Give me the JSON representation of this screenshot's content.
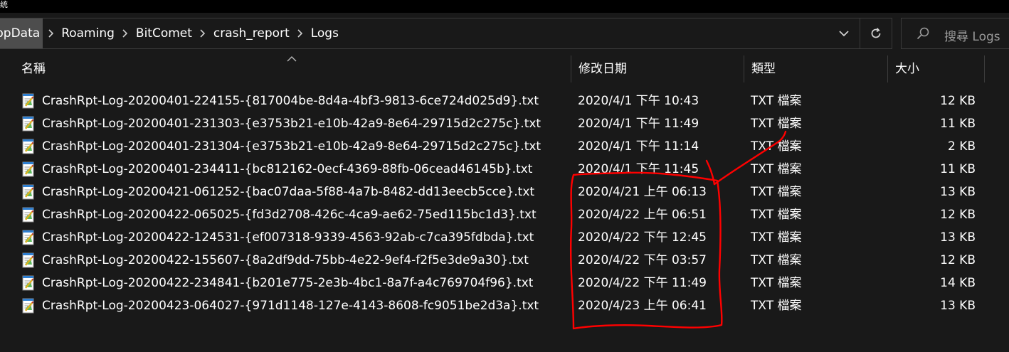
{
  "window": {
    "title_glyph": "统"
  },
  "breadcrumb": {
    "items": [
      "ppData",
      "Roaming",
      "BitComet",
      "crash_report",
      "Logs"
    ]
  },
  "search": {
    "placeholder": "搜尋 Logs"
  },
  "columns": {
    "name": "名稱",
    "date": "修改日期",
    "type": "類型",
    "size": "大小"
  },
  "files": [
    {
      "name": "CrashRpt-Log-20200401-224155-{817004be-8d4a-4bf3-9813-6ce724d025d9}.txt",
      "date": "2020/4/1 下午 10:43",
      "type": "TXT 檔案",
      "size": "12 KB"
    },
    {
      "name": "CrashRpt-Log-20200401-231303-{e3753b21-e10b-42a9-8e64-29715d2c275c}.txt",
      "date": "2020/4/1 下午 11:49",
      "type": "TXT 檔案",
      "size": "11 KB"
    },
    {
      "name": "CrashRpt-Log-20200401-231304-{e3753b21-e10b-42a9-8e64-29715d2c275c}.txt",
      "date": "2020/4/1 下午 11:14",
      "type": "TXT 檔案",
      "size": "2 KB"
    },
    {
      "name": "CrashRpt-Log-20200401-234411-{bc812162-0ecf-4369-88fb-06cead46145b}.txt",
      "date": "2020/4/1 下午 11:45",
      "type": "TXT 檔案",
      "size": "11 KB"
    },
    {
      "name": "CrashRpt-Log-20200421-061252-{bac07daa-5f88-4a7b-8482-dd13eecb5cce}.txt",
      "date": "2020/4/21 上午 06:13",
      "type": "TXT 檔案",
      "size": "13 KB"
    },
    {
      "name": "CrashRpt-Log-20200422-065025-{fd3d2708-426c-4ca9-ae62-75ed115bc1d3}.txt",
      "date": "2020/4/22 上午 06:51",
      "type": "TXT 檔案",
      "size": "12 KB"
    },
    {
      "name": "CrashRpt-Log-20200422-124531-{ef007318-9339-4563-92ab-c7ca395fdbda}.txt",
      "date": "2020/4/22 下午 12:45",
      "type": "TXT 檔案",
      "size": "13 KB"
    },
    {
      "name": "CrashRpt-Log-20200422-155607-{8a2df9dd-75bb-4e22-9ef4-f2f5e3de9a30}.txt",
      "date": "2020/4/22 下午 03:57",
      "type": "TXT 檔案",
      "size": "12 KB"
    },
    {
      "name": "CrashRpt-Log-20200422-234841-{b201e775-2e3b-4bc1-8a7f-a4c769704f96}.txt",
      "date": "2020/4/22 下午 11:49",
      "type": "TXT 檔案",
      "size": "14 KB"
    },
    {
      "name": "CrashRpt-Log-20200423-064027-{971d1148-127e-4143-8608-fc9051be2d3a}.txt",
      "date": "2020/4/23 上午 06:41",
      "type": "TXT 檔案",
      "size": "13 KB"
    }
  ],
  "icons": {
    "breadcrumb_separator": "chevron-right-icon",
    "address_dropdown": "chevron-down-icon",
    "refresh": "refresh-icon",
    "search": "search-icon",
    "sort": "sort-ascending-icon",
    "file": "text-file-icon"
  },
  "colors": {
    "background": "#191919",
    "breadcrumb_highlight": "#4d4d4d",
    "annotation": "#ff0000",
    "placeholder_text": "#9a9a9a"
  }
}
